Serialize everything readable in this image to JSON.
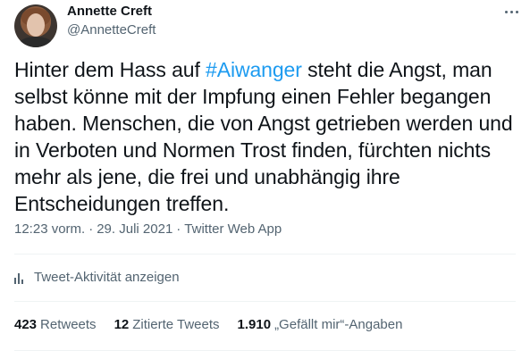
{
  "author": {
    "display_name": "Annette Creft",
    "handle": "@AnnetteCreft"
  },
  "tweet": {
    "text_before": "Hinter dem Hass auf ",
    "hashtag": "#Aiwanger",
    "text_after": " steht die Angst, man selbst könne mit der Impfung einen Fehler begangen haben. Menschen, die von Angst getrieben werden und in Verboten und Normen Trost finden, fürchten nichts mehr als jene, die frei und unabhängig ihre Entscheidungen treffen."
  },
  "meta": {
    "time": "12:23 vorm.",
    "date": "29. Juli 2021",
    "source": "Twitter Web App",
    "separator": "·"
  },
  "activity": {
    "label": "Tweet-Aktivität anzeigen"
  },
  "stats": {
    "retweets_count": "423",
    "retweets_label": "Retweets",
    "quotes_count": "12",
    "quotes_label": "Zitierte Tweets",
    "likes_count": "1.910",
    "likes_label": "„Gefällt mir“-Angaben"
  },
  "colors": {
    "accent": "#1d9bf0",
    "secondary_text": "#536471",
    "primary_text": "#0f1419",
    "divider": "#eff3f4"
  }
}
